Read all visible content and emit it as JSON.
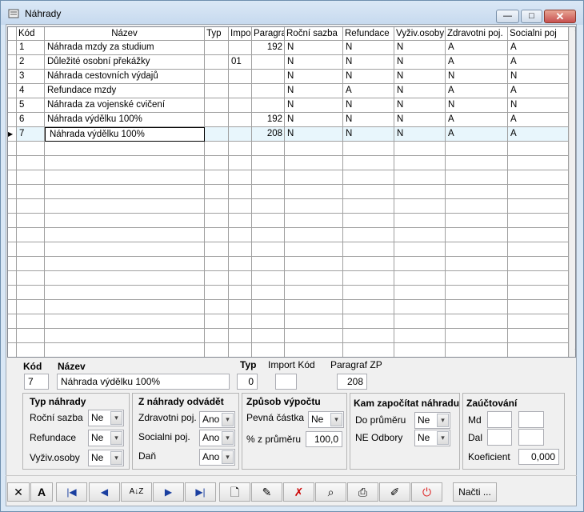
{
  "window": {
    "title": "Náhrady",
    "minimize": "—",
    "maximize": "□",
    "close": "✕"
  },
  "grid": {
    "columns": [
      "Kód",
      "Název",
      "Typ",
      "Impo",
      "Paragra",
      "Roční sazba",
      "Refundace",
      "Vyživ.osoby",
      "Zdravotni poj.",
      "Socialni poj"
    ],
    "rows": [
      [
        "1",
        "Náhrada mzdy za studium",
        "",
        "",
        "192",
        "N",
        "N",
        "N",
        "A",
        "A"
      ],
      [
        "2",
        "Důležité osobní překážky",
        "",
        "01",
        "",
        "N",
        "N",
        "N",
        "A",
        "A"
      ],
      [
        "3",
        "Náhrada cestovních výdajů",
        "",
        "",
        "",
        "N",
        "N",
        "N",
        "N",
        "N"
      ],
      [
        "4",
        "Refundace mzdy",
        "",
        "",
        "",
        "N",
        "A",
        "N",
        "A",
        "A"
      ],
      [
        "5",
        "Náhrada za vojenské cvičení",
        "",
        "",
        "",
        "N",
        "N",
        "N",
        "N",
        "N"
      ],
      [
        "6",
        "Náhrada výdělku 100%",
        "",
        "",
        "192",
        "N",
        "N",
        "N",
        "A",
        "A"
      ],
      [
        "7",
        "Náhrada výdělku 100%",
        "",
        "",
        "208",
        "N",
        "N",
        "N",
        "A",
        "A"
      ]
    ],
    "selected_row_index": 6,
    "row_marker": "▶",
    "scroll_up": "⌃",
    "scroll_down": "⌄"
  },
  "form": {
    "kod_label": "Kód",
    "kod_value": "7",
    "nazev_label": "Název",
    "nazev_value": "Náhrada výdělku 100%",
    "typ_label": "Typ",
    "typ_value": "0",
    "import_label": "Import Kód",
    "import_value": "",
    "paragraf_label": "Paragraf ZP",
    "paragraf_value": "208",
    "typ_nahrady": {
      "title": "Typ náhrady",
      "rocni_label": "Roční sazba",
      "rocni_value": "Ne",
      "refundace_label": "Refundace",
      "refundace_value": "Ne",
      "vyziv_label": "Vyživ.osoby",
      "vyziv_value": "Ne"
    },
    "odvadet": {
      "title": "Z náhrady odvádět",
      "zdrav_label": "Zdravotni poj.",
      "zdrav_value": "Ano",
      "soc_label": "Socialni poj.",
      "soc_value": "Ano",
      "dan_label": "Daň",
      "dan_value": "Ano"
    },
    "vypocet": {
      "title": "Způsob výpočtu",
      "pevna_label": "Pevná částka",
      "pevna_value": "Ne",
      "proc_label": "% z průměru",
      "proc_value": "100,0"
    },
    "kam": {
      "title": "Kam započítat náhradu",
      "prumer_label": "Do průměru",
      "prumer_value": "Ne",
      "odbory_label": "NE Odbory",
      "odbory_value": "Ne"
    },
    "zauct": {
      "title": "Zaúčtování",
      "md_label": "Md",
      "dal_label": "Dal",
      "koef_label": "Koeficient",
      "koef_value": "0,000"
    }
  },
  "toolbar": {
    "close_icon": "✕",
    "font_icon": "A",
    "first_icon": "|◀",
    "prev_icon": "◀",
    "sort_icon": "A↓Z",
    "next_icon": "▶",
    "last_icon": "▶|",
    "new_icon": "🗋",
    "edit_icon": "✎",
    "delete_icon": "✗",
    "find_icon": "⌕",
    "print_icon": "⎙",
    "tools_icon": "✐",
    "power_icon": "⏻",
    "nacti_label": "Načti ..."
  }
}
